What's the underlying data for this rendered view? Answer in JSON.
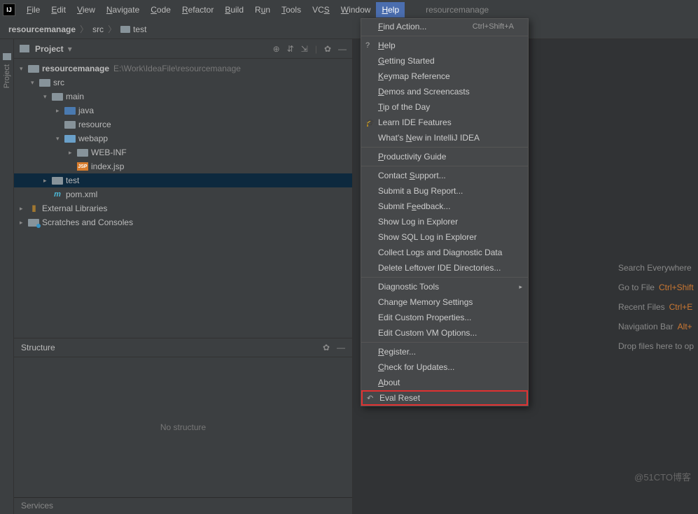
{
  "menubar": {
    "items": [
      "File",
      "Edit",
      "View",
      "Navigate",
      "Code",
      "Refactor",
      "Build",
      "Run",
      "Tools",
      "VCS",
      "Window",
      "Help"
    ],
    "active": "Help",
    "title": "resourcemanage"
  },
  "breadcrumb": {
    "root": "resourcemanage",
    "mid": "src",
    "leaf": "test"
  },
  "gutter": {
    "label": "Project"
  },
  "project_panel": {
    "title": "Project",
    "tree": {
      "root": {
        "name": "resourcemanage",
        "path": "E:\\Work\\IdeaFile\\resourcemanage"
      },
      "src": "src",
      "main": "main",
      "java": "java",
      "resource": "resource",
      "webapp": "webapp",
      "webinf": "WEB-INF",
      "indexjsp": "index.jsp",
      "test": "test",
      "pom": "pom.xml",
      "ext": "External Libraries",
      "scratch": "Scratches and Consoles"
    }
  },
  "structure_panel": {
    "title": "Structure",
    "empty": "No structure"
  },
  "services_panel": {
    "title": "Services"
  },
  "welcome": {
    "search": "Search Everywhere",
    "goto": "Go to File",
    "goto_key": "Ctrl+Shift",
    "recent": "Recent Files",
    "recent_key": "Ctrl+E",
    "navbar": "Navigation Bar",
    "navbar_key": "Alt+",
    "drop": "Drop files here to op"
  },
  "help_menu": {
    "find_action": "Find Action...",
    "find_action_key": "Ctrl+Shift+A",
    "help": "Help",
    "getting_started": "Getting Started",
    "keymap": "Keymap Reference",
    "demos": "Demos and Screencasts",
    "tip": "Tip of the Day",
    "learn": "Learn IDE Features",
    "whatsnew": "What's New in IntelliJ IDEA",
    "productivity": "Productivity Guide",
    "support": "Contact Support...",
    "bug": "Submit a Bug Report...",
    "feedback": "Submit Feedback...",
    "showlog": "Show Log in Explorer",
    "sqllog": "Show SQL Log in Explorer",
    "collect": "Collect Logs and Diagnostic Data",
    "deletedir": "Delete Leftover IDE Directories...",
    "diag": "Diagnostic Tools",
    "memory": "Change Memory Settings",
    "customprops": "Edit Custom Properties...",
    "customvm": "Edit Custom VM Options...",
    "register": "Register...",
    "updates": "Check for Updates...",
    "about": "About",
    "eval": "Eval Reset"
  },
  "watermark": "@51CTO博客"
}
